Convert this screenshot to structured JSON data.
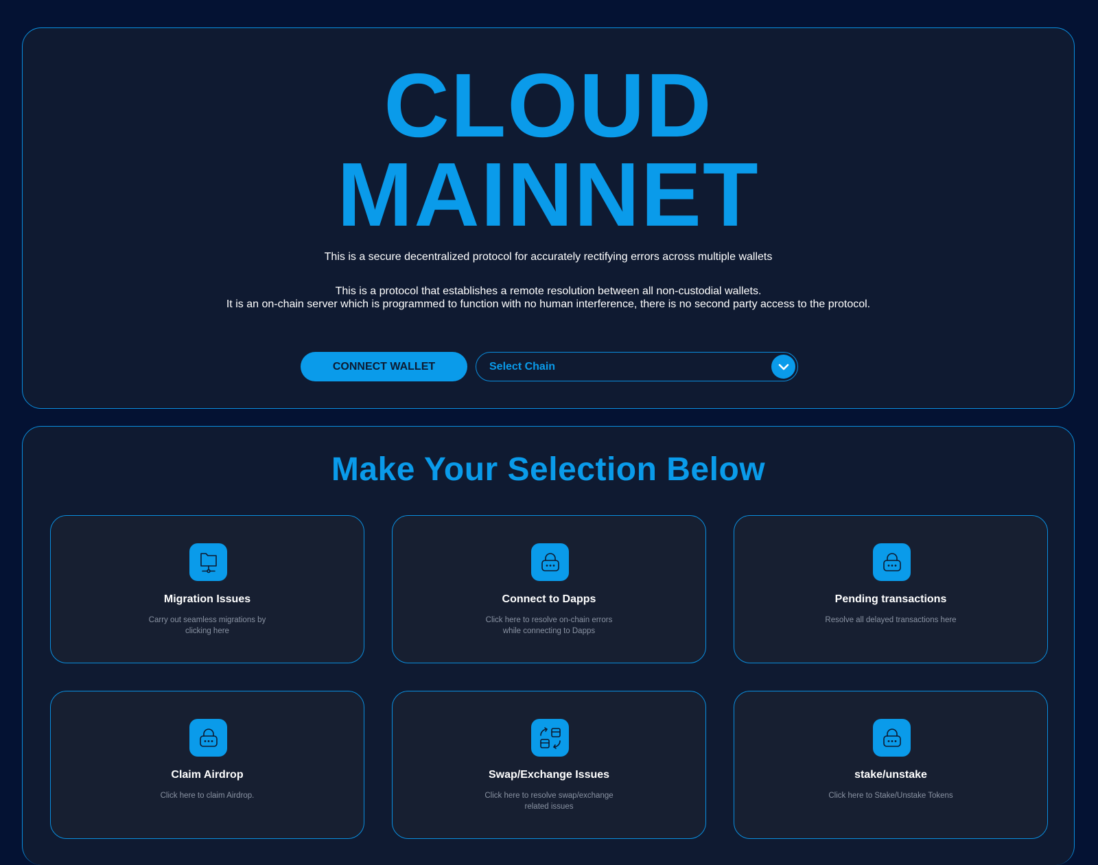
{
  "hero": {
    "title_line1": "CLOUD",
    "title_line2": "MAINNET",
    "tagline": "This is a secure decentralized protocol for accurately rectifying errors across multiple wallets",
    "description_line1": "This is a protocol that establishes a remote resolution between all non-custodial wallets.",
    "description_line2": "It is an on-chain server which is programmed to function with no human interference, there is no second party access to the protocol.",
    "connect_wallet_label": "CONNECT WALLET",
    "chain_select": {
      "selected": "Select Chain",
      "icon": "chevron-down-icon"
    }
  },
  "selection": {
    "heading": "Make Your Selection Below",
    "cards": [
      {
        "title": "Migration Issues",
        "description": "Carry out seamless migrations by clicking here",
        "icon": "folder-network-icon"
      },
      {
        "title": "Connect to Dapps",
        "description": "Click here to resolve on-chain errors while connecting to Dapps",
        "icon": "lock-icon"
      },
      {
        "title": "Pending transactions",
        "description": "Resolve all delayed transactions here",
        "icon": "lock-icon"
      },
      {
        "title": "Claim Airdrop",
        "description": "Click here to claim Airdrop.",
        "icon": "lock-icon"
      },
      {
        "title": "Swap/Exchange Issues",
        "description": "Click here to resolve swap/exchange related issues",
        "icon": "swap-cards-icon"
      },
      {
        "title": "stake/unstake",
        "description": "Click here to Stake/Unstake Tokens",
        "icon": "lock-icon"
      }
    ]
  },
  "colors": {
    "page_background": "#041233",
    "panel_background": "#0f1a31",
    "card_background": "#171f31",
    "accent": "#0a9bea",
    "border": "#0a8fe0",
    "muted_text": "#8a93a3"
  }
}
